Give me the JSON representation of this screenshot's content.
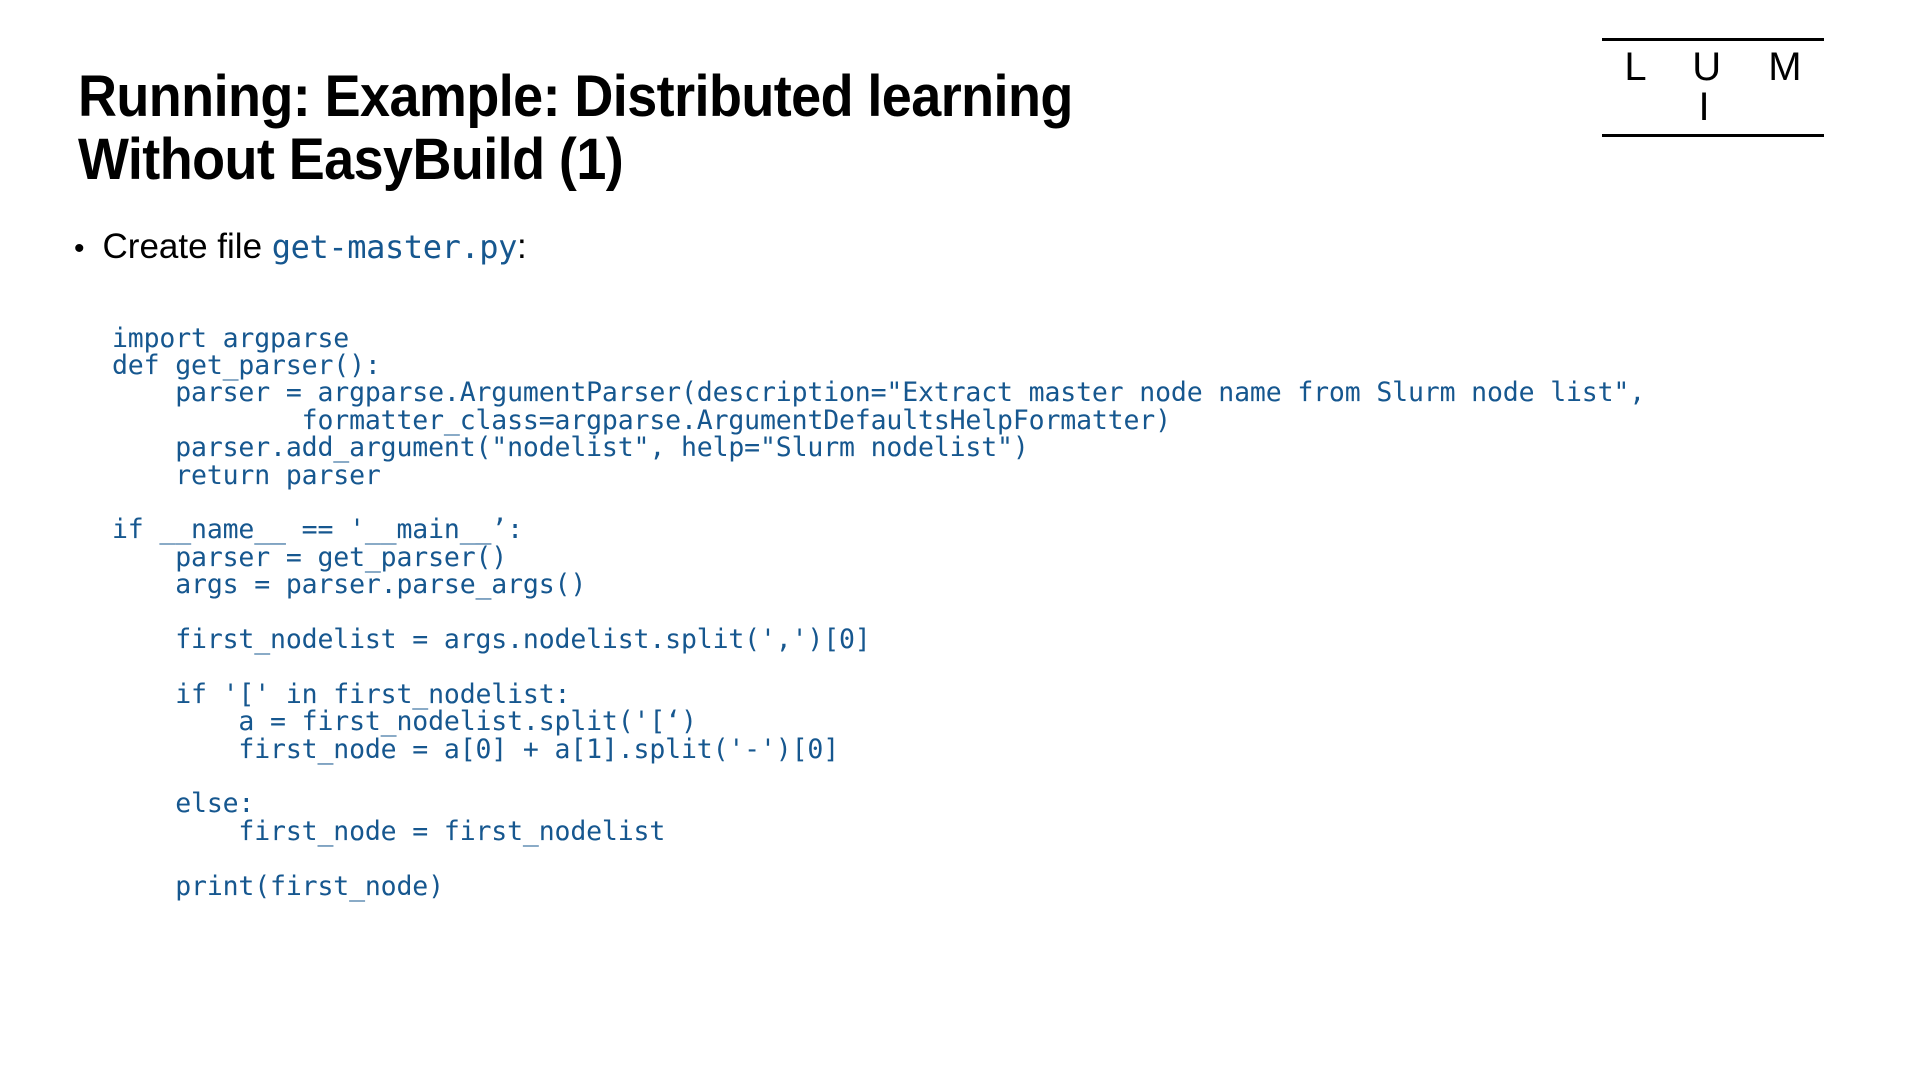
{
  "slide": {
    "title": "Running: Example: Distributed learning\nWithout EasyBuild (1)",
    "logo": {
      "text": "L U M I",
      "name": "lumi-logo"
    },
    "bullet": {
      "marker": "•",
      "text_before": "Create file",
      "filename": "get-master.py",
      "text_after": ":"
    },
    "code": {
      "language": "python",
      "color": "#16578f",
      "content": "import argparse\ndef get_parser():\n    parser = argparse.ArgumentParser(description=\"Extract master node name from Slurm node list\",\n            formatter_class=argparse.ArgumentDefaultsHelpFormatter)\n    parser.add_argument(\"nodelist\", help=\"Slurm nodelist\")\n    return parser\n\nif __name__ == '__main__’:\n    parser = get_parser()\n    args = parser.parse_args()\n\n    first_nodelist = args.nodelist.split(',')[0]\n\n    if '[' in first_nodelist:\n        a = first_nodelist.split('[‘)\n        first_node = a[0] + a[1].split('-')[0]\n\n    else:\n        first_node = first_nodelist\n\n    print(first_node)",
      "lines": [
        "import argparse",
        "def get_parser():",
        "    parser = argparse.ArgumentParser(description=\"Extract master node name from Slurm node list\",",
        "            formatter_class=argparse.ArgumentDefaultsHelpFormatter)",
        "    parser.add_argument(\"nodelist\", help=\"Slurm nodelist\")",
        "    return parser",
        "",
        "if __name__ == '__main__’:",
        "    parser = get_parser()",
        "    args = parser.parse_args()",
        "",
        "    first_nodelist = args.nodelist.split(',')[0]",
        "",
        "    if '[' in first_nodelist:",
        "        a = first_nodelist.split('[‘)",
        "        first_node = a[0] + a[1].split('-')[0]",
        "",
        "    else:",
        "        first_node = first_nodelist",
        "",
        "    print(first_node)"
      ]
    },
    "colors": {
      "background": "#ffffff",
      "text": "#000000",
      "code_blue": "#16578f"
    }
  }
}
